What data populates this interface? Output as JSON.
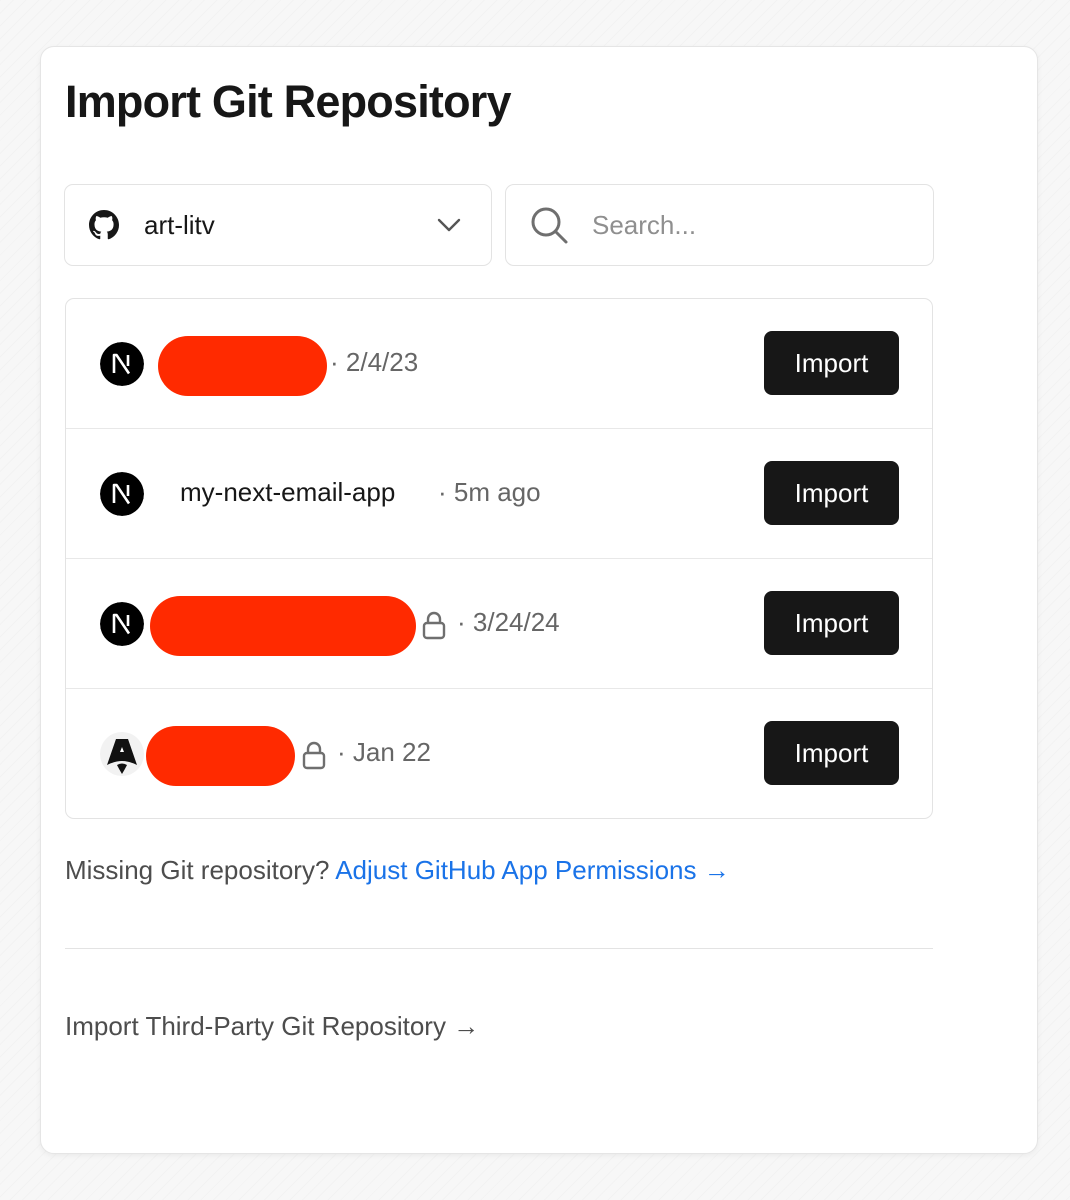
{
  "page": {
    "title": "Import Git Repository"
  },
  "scope": {
    "account": "art-litv",
    "icon": "github-icon"
  },
  "search": {
    "placeholder": "Search..."
  },
  "repos": [
    {
      "name": "",
      "redacted": true,
      "private": false,
      "meta": "· 2/4/23",
      "framework": "nextjs-icon",
      "button": "Import"
    },
    {
      "name": "my-next-email-app",
      "redacted": false,
      "private": false,
      "meta": "· 5m ago",
      "framework": "nextjs-icon",
      "button": "Import"
    },
    {
      "name": "",
      "redacted": true,
      "private": true,
      "meta": "· 3/24/24",
      "framework": "nextjs-icon",
      "button": "Import"
    },
    {
      "name": "",
      "redacted": true,
      "private": true,
      "meta": "· Jan 22",
      "framework": "astro-icon",
      "button": "Import"
    }
  ],
  "footer": {
    "missing_text": "Missing Git repository?",
    "permissions_link": "Adjust GitHub App Permissions →",
    "third_party_link": "Import Third-Party Git Repository →"
  },
  "colors": {
    "button_bg": "#171717",
    "link": "#1a73e8",
    "redaction": "#ff2a00"
  }
}
